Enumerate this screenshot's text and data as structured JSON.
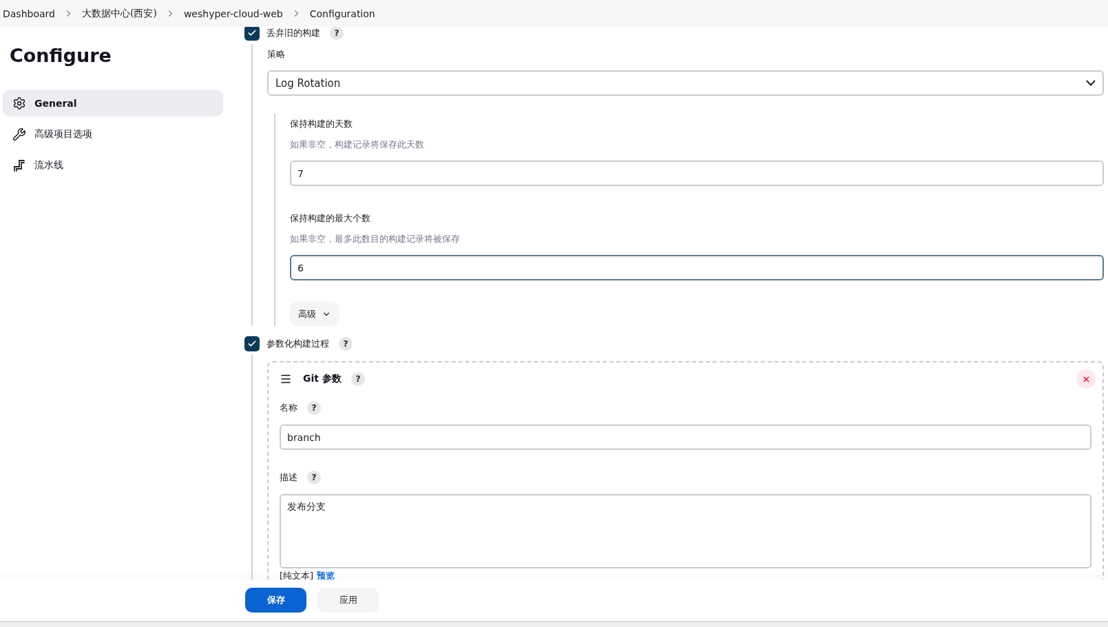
{
  "breadcrumbs": [
    "Dashboard",
    "大数据中心(西安)",
    "weshyper-cloud-web",
    "Configuration"
  ],
  "sidebar": {
    "title": "Configure",
    "items": [
      {
        "label": "General",
        "kind": "gear",
        "selected": true
      },
      {
        "label": "高级项目选项",
        "kind": "wrench",
        "selected": false
      },
      {
        "label": "流水线",
        "kind": "pipeline",
        "selected": false
      }
    ]
  },
  "discard_old_builds": {
    "label": "丢弃旧的构建",
    "checked": true,
    "help": "?",
    "strategy_label": "策略",
    "strategy_value": "Log Rotation",
    "fields": [
      {
        "label": "保持构建的天数",
        "hint": "如果非空，构建记录将保存此天数",
        "value": "7",
        "focused": false
      },
      {
        "label": "保持构建的最大个数",
        "hint": "如果非空，最多此数目的构建记录将被保存",
        "value": "6",
        "focused": true
      }
    ],
    "advanced_button": "高级"
  },
  "parameterized_build": {
    "label": "参数化构建过程",
    "checked": true,
    "help": "?",
    "parameter": {
      "title": "Git 参数",
      "help": "?",
      "name_label": "名称",
      "name_help": "?",
      "name_value": "branch",
      "description_label": "描述",
      "description_help": "?",
      "description_value": "发布分支",
      "format_text": "[纯文本]",
      "preview_link": "预览"
    }
  },
  "footer": {
    "save_button": "保存",
    "apply_button": "应用"
  }
}
